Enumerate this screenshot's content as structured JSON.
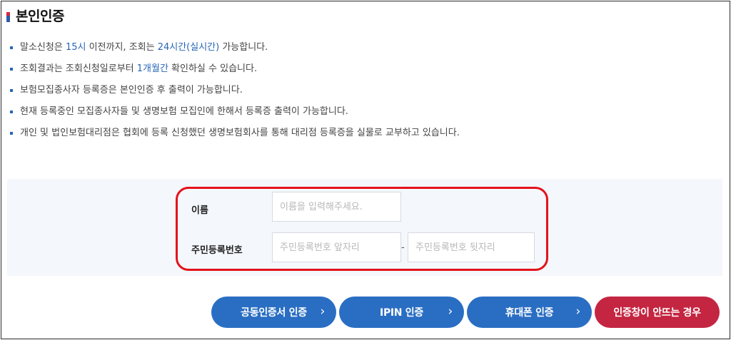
{
  "page": {
    "title": "본인인증"
  },
  "notices": [
    {
      "parts": [
        "말소신청은 ",
        "15시",
        " 이전까지, 조회는 ",
        "24시간(실시간)",
        " 가능합니다."
      ]
    },
    {
      "parts": [
        "조회결과는 조회신청일로부터 ",
        "1개월간",
        " 확인하실 수 있습니다."
      ]
    },
    {
      "text": "보험모집종사자 등록증은 본인인증 후 출력이 가능합니다."
    },
    {
      "text": "현재 등록중인 모집종사자들 및 생명보험 모집인에 한해서 등록증 출력이 가능합니다."
    },
    {
      "text": "개인 및 법인보험대리점은 협회에 등록 신청했던 생명보험회사를 통해 대리점 등록증을 실물로 교부하고 있습니다."
    }
  ],
  "form": {
    "name_label": "이름",
    "name_placeholder": "이름을 입력해주세요.",
    "rrn_label": "주민등록번호",
    "rrn_front_placeholder": "주민등록번호 앞자리",
    "rrn_separator": "-",
    "rrn_back_placeholder": "주민등록번호 뒷자리"
  },
  "buttons": {
    "cert": "공동인증서 인증",
    "ipin": "IPIN 인증",
    "phone": "휴대폰 인증",
    "help": "인증창이 안뜨는 경우",
    "chevron": "›"
  },
  "colors": {
    "accent_blue": "#2766b6",
    "button_blue": "#2a6ec3",
    "button_red": "#c42541",
    "highlight_outline": "#e4121c"
  }
}
